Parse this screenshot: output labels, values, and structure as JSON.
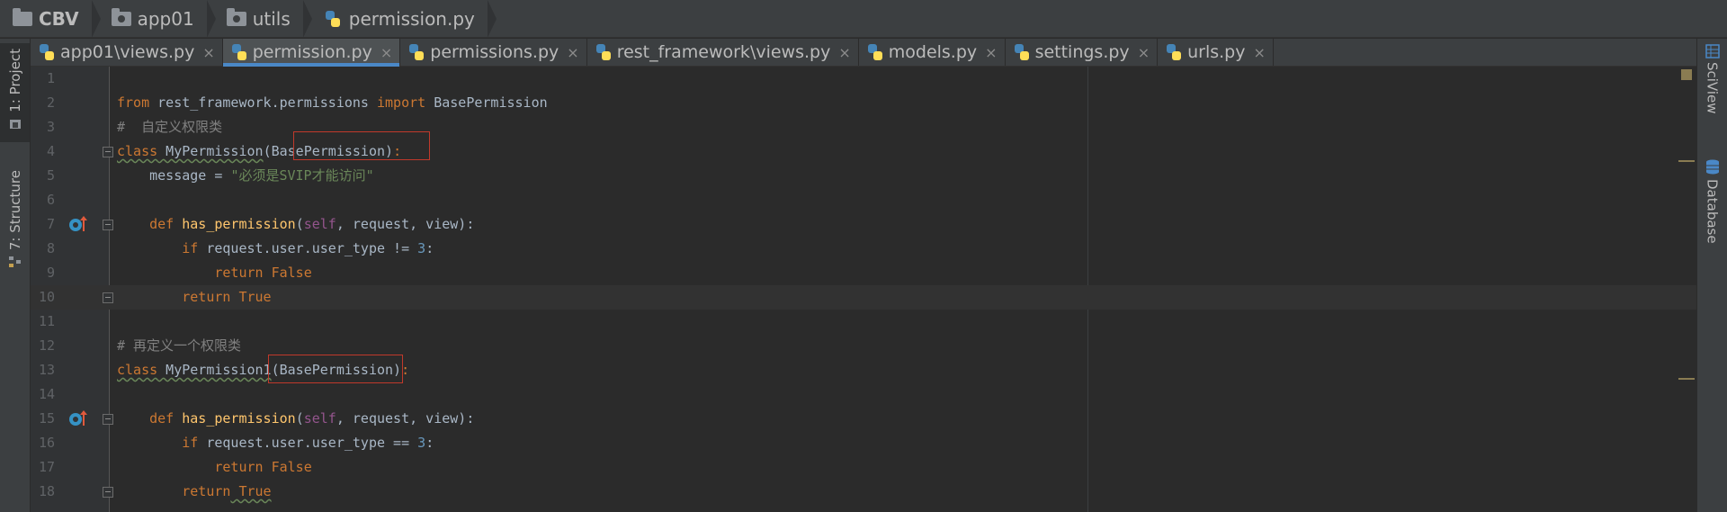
{
  "breadcrumb": [
    {
      "label": "CBV",
      "icon": "folder-icon"
    },
    {
      "label": "app01",
      "icon": "package-folder-icon"
    },
    {
      "label": "utils",
      "icon": "package-folder-icon"
    },
    {
      "label": "permission.py",
      "icon": "python-file-icon"
    }
  ],
  "left_tools": [
    {
      "label": "1: Project"
    },
    {
      "label": "7: Structure"
    }
  ],
  "right_tools": [
    {
      "label": "SciView"
    },
    {
      "label": "Database"
    }
  ],
  "tabs": [
    {
      "label": "app01\\views.py",
      "active": false
    },
    {
      "label": "permission.py",
      "active": true
    },
    {
      "label": "permissions.py",
      "active": false
    },
    {
      "label": "rest_framework\\views.py",
      "active": false
    },
    {
      "label": "models.py",
      "active": false
    },
    {
      "label": "settings.py",
      "active": false
    },
    {
      "label": "urls.py",
      "active": false
    }
  ],
  "close_glyph": "×",
  "editor": {
    "line_numbers": [
      "1",
      "2",
      "3",
      "4",
      "5",
      "6",
      "7",
      "8",
      "9",
      "10",
      "11",
      "12",
      "13",
      "14",
      "15",
      "16",
      "17",
      "18"
    ],
    "code": {
      "l2_kw1": "from",
      "l2_mod": " rest_framework.permissions ",
      "l2_kw2": "import",
      "l2_name": " BasePermission",
      "l3_comment": "#  自定义权限类",
      "l4_kw": "class",
      "l4_name": " MyPermission",
      "l4_base": "(BasePermission)",
      "l4_colon": ":",
      "l5_attr": "    message = ",
      "l5_str": "\"必须是SVIP才能访问\"",
      "l7_indent": "    ",
      "l7_kw": "def",
      "l7_fn": " has_permission",
      "l7_open": "(",
      "l7_self": "self",
      "l7_rest": ", request, view):",
      "l8_indent": "        ",
      "l8_kw": "if",
      "l8_expr": " request.user.user_type != ",
      "l8_num": "3",
      "l8_colon": ":",
      "l9_indent": "            ",
      "l9_kw": "return",
      "l9_val": " False",
      "l10_indent": "        ",
      "l10_kw": "return",
      "l10_val": " True",
      "l12_comment": "# 再定义一个权限类",
      "l13_kw": "class",
      "l13_name": " MyPermission1",
      "l13_base": "(BasePermission)",
      "l13_colon": ":",
      "l15_indent": "    ",
      "l15_kw": "def",
      "l15_fn": " has_permission",
      "l15_open": "(",
      "l15_self": "self",
      "l15_rest": ", request, view):",
      "l16_indent": "        ",
      "l16_kw": "if",
      "l16_expr": " request.user.user_type == ",
      "l16_num": "3",
      "l16_colon": ":",
      "l17_indent": "            ",
      "l17_kw": "return",
      "l17_val": " False",
      "l18_indent": "        ",
      "l18_kw": "return",
      "l18_val": " True"
    }
  },
  "colors": {
    "accent": "#4a88c7",
    "keyword": "#cc7832",
    "function": "#ffc66d",
    "string": "#6a8759",
    "number": "#6897bb",
    "comment": "#808080",
    "highlight_box": "#c0392b"
  }
}
